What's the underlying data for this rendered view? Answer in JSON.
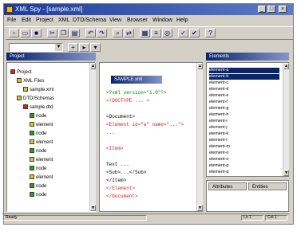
{
  "window": {
    "title": "XML Spy - [sample.xml]",
    "controls": {
      "minimize": "_",
      "maximize": "□",
      "close": "×"
    }
  },
  "menu": [
    "File",
    "Edit",
    "Project",
    "XML",
    "DTD/Schema",
    "View",
    "Browser",
    "Window",
    "Help"
  ],
  "toolbar": {
    "buttons": [
      "new-icon",
      "open-icon",
      "save-icon",
      "cut-icon",
      "copy-icon",
      "paste-icon",
      "undo-icon",
      "redo-icon",
      "find-icon",
      "replace-icon",
      "grid-view-icon",
      "text-view-icon",
      "browser-view-icon",
      "validate-icon",
      "well-formed-icon",
      "help-icon"
    ]
  },
  "panes": {
    "project": {
      "title": "Project"
    },
    "editor": {
      "title": "SAMPLE.xml"
    },
    "elements": {
      "title": "Elements"
    },
    "attributes": {
      "title": "Attributes"
    },
    "entities": {
      "title": "Entities"
    }
  },
  "tree": [
    {
      "label": "Project",
      "level": 0,
      "color": "#d02020"
    },
    {
      "label": "XML Files",
      "level": 1,
      "color": "#e8c020"
    },
    {
      "label": "sample.xml",
      "level": 2,
      "color": "#e8c020"
    },
    {
      "label": "DTD/Schemas",
      "level": 1,
      "color": "#e8c020"
    },
    {
      "label": "sample.dtd",
      "level": 2,
      "color": "#d02020"
    },
    {
      "label": "node",
      "level": 3,
      "color": "#20a020"
    },
    {
      "label": "element",
      "level": 3,
      "color": "#e8c020"
    },
    {
      "label": "node",
      "level": 3,
      "color": "#20a020"
    },
    {
      "label": "element",
      "level": 3,
      "color": "#e8c020"
    },
    {
      "label": "node",
      "level": 3,
      "color": "#20a020"
    },
    {
      "label": "element",
      "level": 3,
      "color": "#e8c020"
    },
    {
      "label": "node",
      "level": 3,
      "color": "#20a020"
    },
    {
      "label": "element",
      "level": 3,
      "color": "#e8c020"
    },
    {
      "label": "node",
      "level": 3,
      "color": "#20a020"
    },
    {
      "label": "node",
      "level": 3,
      "color": "#20a020"
    }
  ],
  "editor_lines": [
    {
      "text": "<?xml version=\"1.0\"?>",
      "color": "#008000"
    },
    {
      "text": "<!DOCTYPE ... >",
      "color": "#d02020"
    },
    {
      "text": "",
      "color": "#000000"
    },
    {
      "text": "<Document>",
      "color": "#000000"
    },
    {
      "text": "  <Element id=\"a\" name=\"...\">",
      "color": "#d02020"
    },
    {
      "text": "  ...",
      "color": "#d02020"
    },
    {
      "text": "",
      "color": "#000000"
    },
    {
      "text": "  <Item>",
      "color": "#d02020"
    },
    {
      "text": "",
      "color": "#000000"
    },
    {
      "text": "    Text ...",
      "color": "#000000"
    },
    {
      "text": "    <Sub>...</Sub>",
      "color": "#000000"
    },
    {
      "text": "    </Item>",
      "color": "#000000"
    },
    {
      "text": "  </Element>",
      "color": "#d02020"
    },
    {
      "text": "</Document>",
      "color": "#d02020"
    }
  ],
  "element_list": [
    "element-a",
    "element-b",
    "element-c",
    "element-d",
    "element-e",
    "element-f",
    "element-g",
    "element-h",
    "element-i",
    "element-j",
    "element-k",
    "element-l",
    "element-m",
    "element-n",
    "element-o",
    "element-p",
    "element-q"
  ],
  "status": {
    "left": "Ready",
    "pos": "Ln 1",
    "col": "Col 1"
  }
}
